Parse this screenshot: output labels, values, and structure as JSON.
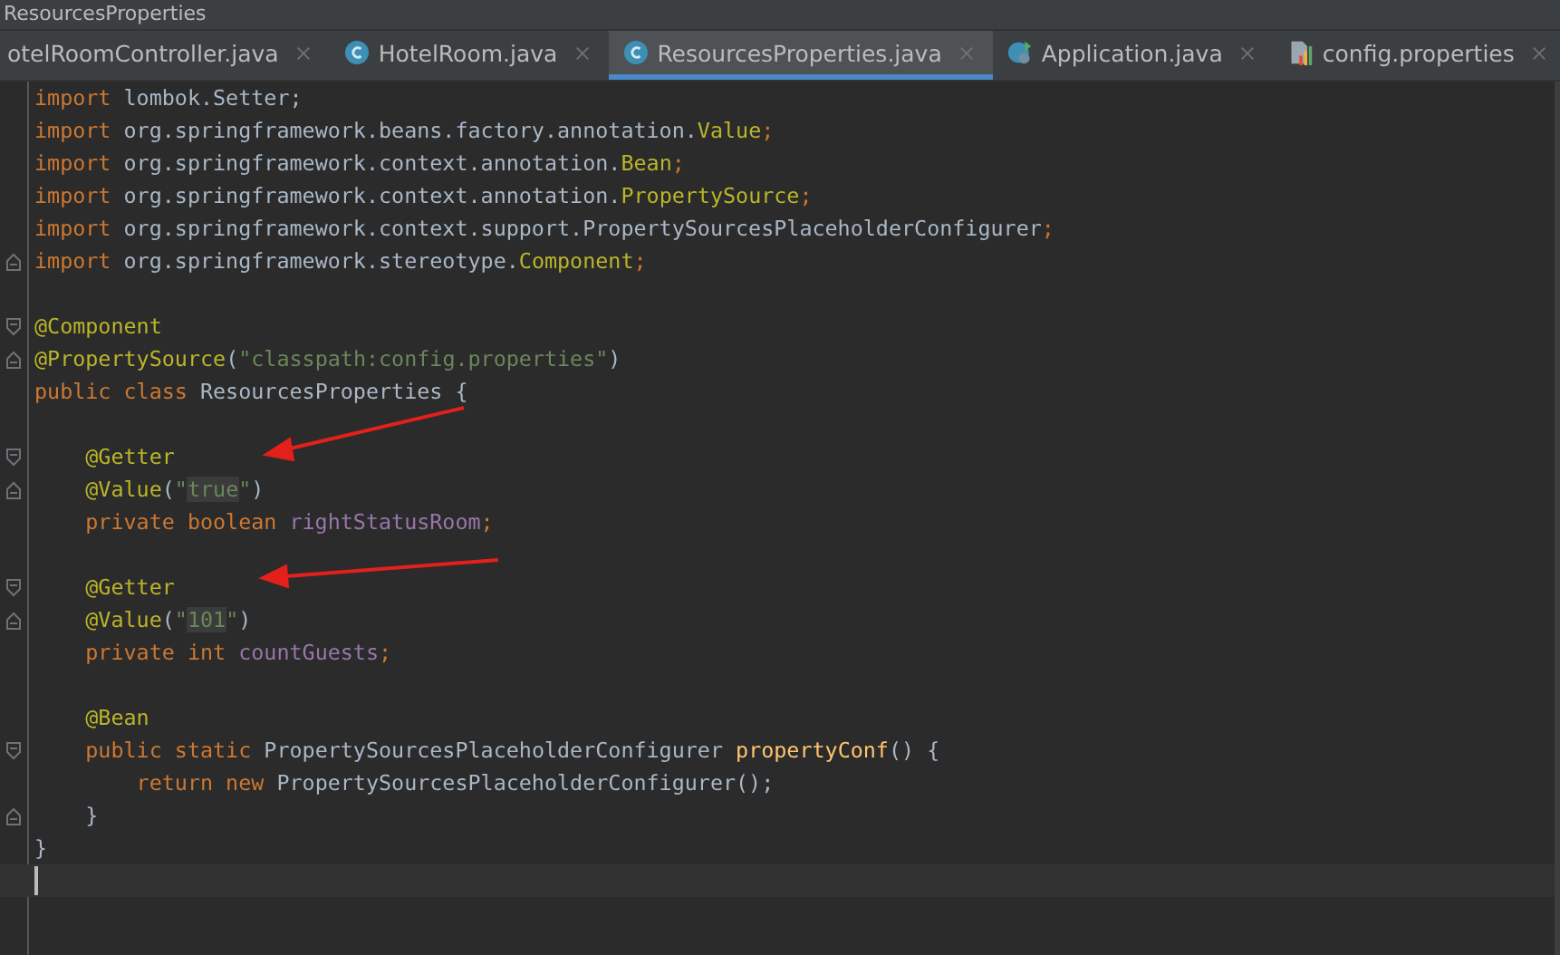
{
  "window": {
    "title": "ResourcesProperties"
  },
  "tabs": [
    {
      "label": "otelRoomController.java",
      "kind": "plain",
      "selected": false
    },
    {
      "label": "HotelRoom.java",
      "kind": "class",
      "selected": false
    },
    {
      "label": "ResourcesProperties.java",
      "kind": "class",
      "selected": true
    },
    {
      "label": "Application.java",
      "kind": "app",
      "selected": false
    },
    {
      "label": "config.properties",
      "kind": "properties",
      "selected": false
    }
  ],
  "code_lines": [
    {
      "tokens": [
        {
          "kind": "keyword",
          "text": "import "
        },
        {
          "kind": "plain",
          "text": "lombok.Setter;"
        }
      ]
    },
    {
      "tokens": [
        {
          "kind": "keyword",
          "text": "import "
        },
        {
          "kind": "plain",
          "text": "org.springframework.beans.factory.annotation."
        },
        {
          "kind": "type",
          "text": "Value"
        },
        {
          "kind": "keyword",
          "text": ";"
        }
      ]
    },
    {
      "tokens": [
        {
          "kind": "keyword",
          "text": "import "
        },
        {
          "kind": "plain",
          "text": "org.springframework.context.annotation."
        },
        {
          "kind": "type",
          "text": "Bean"
        },
        {
          "kind": "keyword",
          "text": ";"
        }
      ]
    },
    {
      "tokens": [
        {
          "kind": "keyword",
          "text": "import "
        },
        {
          "kind": "plain",
          "text": "org.springframework.context.annotation."
        },
        {
          "kind": "type",
          "text": "PropertySource"
        },
        {
          "kind": "keyword",
          "text": ";"
        }
      ]
    },
    {
      "tokens": [
        {
          "kind": "keyword",
          "text": "import "
        },
        {
          "kind": "plain",
          "text": "org.springframework.context.support.PropertySourcesPlaceholderConfigurer"
        },
        {
          "kind": "keyword",
          "text": ";"
        }
      ]
    },
    {
      "kind": "closer",
      "tokens": [
        {
          "kind": "keyword",
          "text": "import "
        },
        {
          "kind": "plain",
          "text": "org.springframework.stereotype."
        },
        {
          "kind": "type",
          "text": "Component"
        },
        {
          "kind": "keyword",
          "text": ";"
        }
      ]
    },
    {
      "kind": "blank"
    },
    {
      "kind": "opener",
      "tokens": [
        {
          "kind": "annotation",
          "text": "@Component"
        }
      ]
    },
    {
      "kind": "closer",
      "tokens": [
        {
          "kind": "annotation",
          "text": "@PropertySource"
        },
        {
          "kind": "plain",
          "text": "("
        },
        {
          "kind": "string",
          "text": "\"classpath:config.properties\""
        },
        {
          "kind": "plain",
          "text": ")"
        }
      ]
    },
    {
      "tokens": [
        {
          "kind": "keyword",
          "text": "public class "
        },
        {
          "kind": "plain",
          "text": "ResourcesProperties {"
        }
      ]
    },
    {
      "kind": "blank"
    },
    {
      "kind": "opener",
      "tokens": [
        {
          "kind": "annotation",
          "text": "    @Getter"
        }
      ]
    },
    {
      "kind": "closer",
      "tokens": [
        {
          "kind": "annotation",
          "text": "    @Value"
        },
        {
          "kind": "plain",
          "text": "("
        },
        {
          "kind": "string",
          "text": "\""
        },
        {
          "kind": "string-highlighted",
          "text": "true"
        },
        {
          "kind": "string",
          "text": "\""
        },
        {
          "kind": "plain",
          "text": ")"
        }
      ]
    },
    {
      "tokens": [
        {
          "kind": "keyword",
          "text": "    private boolean "
        },
        {
          "kind": "field",
          "text": "rightStatusRoom"
        },
        {
          "kind": "keyword",
          "text": ";"
        }
      ]
    },
    {
      "kind": "blank"
    },
    {
      "kind": "opener",
      "tokens": [
        {
          "kind": "annotation",
          "text": "    @Getter"
        }
      ]
    },
    {
      "kind": "closer",
      "tokens": [
        {
          "kind": "annotation",
          "text": "    @Value"
        },
        {
          "kind": "plain",
          "text": "("
        },
        {
          "kind": "string",
          "text": "\""
        },
        {
          "kind": "string-highlighted",
          "text": "101"
        },
        {
          "kind": "string",
          "text": "\""
        },
        {
          "kind": "plain",
          "text": ")"
        }
      ]
    },
    {
      "tokens": [
        {
          "kind": "keyword",
          "text": "    private int "
        },
        {
          "kind": "field",
          "text": "countGuests"
        },
        {
          "kind": "keyword",
          "text": ";"
        }
      ]
    },
    {
      "kind": "blank"
    },
    {
      "tokens": [
        {
          "kind": "annotation",
          "text": "    @Bean"
        }
      ]
    },
    {
      "kind": "opener",
      "tokens": [
        {
          "kind": "keyword",
          "text": "    public static "
        },
        {
          "kind": "plain",
          "text": "PropertySourcesPlaceholderConfigurer "
        },
        {
          "kind": "method",
          "text": "propertyConf"
        },
        {
          "kind": "plain",
          "text": "() {"
        }
      ]
    },
    {
      "tokens": [
        {
          "kind": "keyword",
          "text": "        return new "
        },
        {
          "kind": "plain",
          "text": "PropertySourcesPlaceholderConfigurer();"
        }
      ]
    },
    {
      "kind": "closer",
      "tokens": [
        {
          "kind": "plain",
          "text": "    }"
        }
      ]
    },
    {
      "tokens": [
        {
          "kind": "plain",
          "text": "}"
        }
      ]
    },
    {
      "kind": "blank",
      "current": true
    }
  ]
}
